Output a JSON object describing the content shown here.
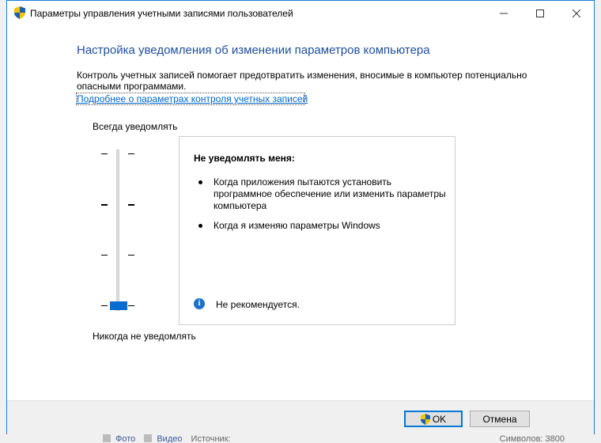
{
  "window": {
    "title": "Параметры управления учетными записями пользователей"
  },
  "main": {
    "heading": "Настройка уведомления об изменении параметров компьютера",
    "description": "Контроль учетных записей помогает предотвратить изменения, вносимые в компьютер потенциально опасными программами.",
    "learn_more_link": "Подробнее о параметрах контроля учетных записей"
  },
  "slider": {
    "top_label": "Всегда уведомлять",
    "bottom_label": "Никогда не уведомлять",
    "levels": 4,
    "selected_level": 1
  },
  "info_panel": {
    "title": "Не уведомлять меня:",
    "bullets": [
      "Когда приложения пытаются установить программное обеспечение или изменить параметры компьютера",
      "Когда я изменяю параметры Windows"
    ],
    "note": "Не рекомендуется."
  },
  "buttons": {
    "ok": "OK",
    "cancel": "Отмена"
  },
  "background": {
    "item1": "Фото",
    "item2": "Видео",
    "item3": "Источник:",
    "right": "Символов: 3800"
  },
  "colors": {
    "accent": "#0a6ccf",
    "heading": "#1e4fa0",
    "link": "#0066cc"
  }
}
